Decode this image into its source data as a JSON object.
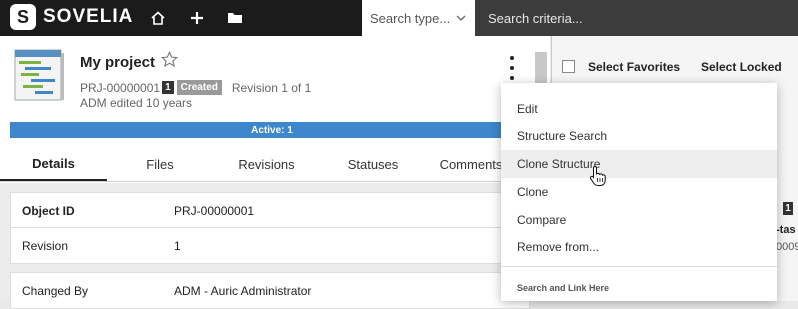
{
  "app": {
    "logo_letter": "S",
    "logo_text": "SOVELIA"
  },
  "topbar": {
    "icons": [
      "home-icon",
      "plus-icon",
      "folder-icon"
    ],
    "search_type": "Search type...",
    "search_criteria_placeholder": "Search criteria..."
  },
  "object": {
    "title": "My project",
    "id": "PRJ-00000001",
    "revision_badge": "1",
    "status": "Created",
    "revision_info": "Revision 1 of 1",
    "edited": "ADM edited 10 years",
    "active_bar": "Active: 1"
  },
  "tabs": [
    {
      "label": "Details",
      "active": true
    },
    {
      "label": "Files",
      "active": false
    },
    {
      "label": "Revisions",
      "active": false
    },
    {
      "label": "Statuses",
      "active": false
    },
    {
      "label": "Comments",
      "active": false
    }
  ],
  "details": {
    "rows": [
      {
        "label": "Object ID",
        "value": "PRJ-00000001",
        "bold": true
      },
      {
        "label": "Revision",
        "value": "1",
        "bold": false
      }
    ],
    "rows2": [
      {
        "label": "Changed By",
        "value": "ADM - Auric Administrator"
      }
    ]
  },
  "right_panel": {
    "select_favorites": "Select Favorites",
    "select_locked": "Select Locked",
    "badge": "1",
    "text1": "-tas",
    "text2": "0009"
  },
  "menu": {
    "items": [
      "Edit",
      "Structure Search",
      "Clone Structure",
      "Clone",
      "Compare",
      "Remove from..."
    ],
    "hovered_index": 2,
    "section_title": "Search and Link Here"
  },
  "colors": {
    "topbar": "#1b1b1b",
    "active_bar": "#3d87cc",
    "status_badge": "#9a9a9a"
  }
}
